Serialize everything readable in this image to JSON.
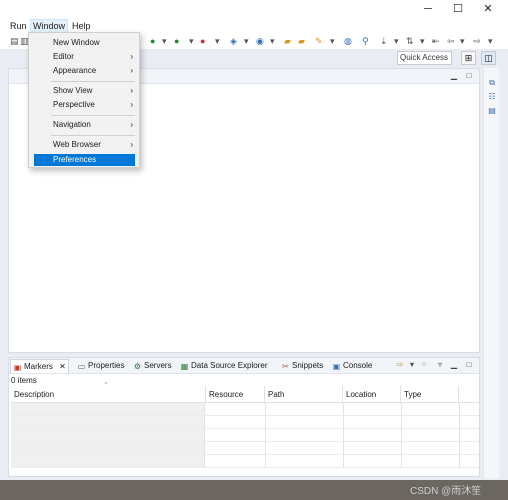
{
  "titlebar": {
    "minimize": "─",
    "maximize": "☐",
    "close": "✕"
  },
  "menubar": {
    "items": [
      {
        "label": "Run"
      },
      {
        "label": "Window"
      },
      {
        "label": "Help"
      }
    ]
  },
  "quick_access": {
    "label": "Quick Access"
  },
  "window_menu": {
    "items": [
      {
        "label": "New Window",
        "submenu": false
      },
      {
        "label": "Editor",
        "submenu": true
      },
      {
        "label": "Appearance",
        "submenu": true
      },
      {
        "label": "Show View",
        "submenu": true
      },
      {
        "label": "Perspective",
        "submenu": true
      },
      {
        "label": "Navigation",
        "submenu": true
      },
      {
        "label": "Web Browser",
        "submenu": true
      },
      {
        "label": "Preferences",
        "submenu": false,
        "highlighted": true
      }
    ],
    "submenu_arrow": "›"
  },
  "bottom_panel": {
    "tabs": [
      {
        "label": "Markers",
        "icon": "markers-icon",
        "active": true
      },
      {
        "label": "Properties",
        "icon": "properties-icon"
      },
      {
        "label": "Servers",
        "icon": "servers-icon"
      },
      {
        "label": "Data Source Explorer",
        "icon": "data-source-icon"
      },
      {
        "label": "Snippets",
        "icon": "snippets-icon"
      },
      {
        "label": "Console",
        "icon": "console-icon"
      }
    ],
    "close_glyph": "✕",
    "items_count": "0 items",
    "columns": [
      "Description",
      "Resource",
      "Path",
      "Location",
      "Type"
    ]
  },
  "watermark": "CSDN @雨沐笙",
  "colors": {
    "selection": "#0078d7",
    "menu_bg": "#f2f2f2",
    "panel_border": "#d7dde6"
  }
}
